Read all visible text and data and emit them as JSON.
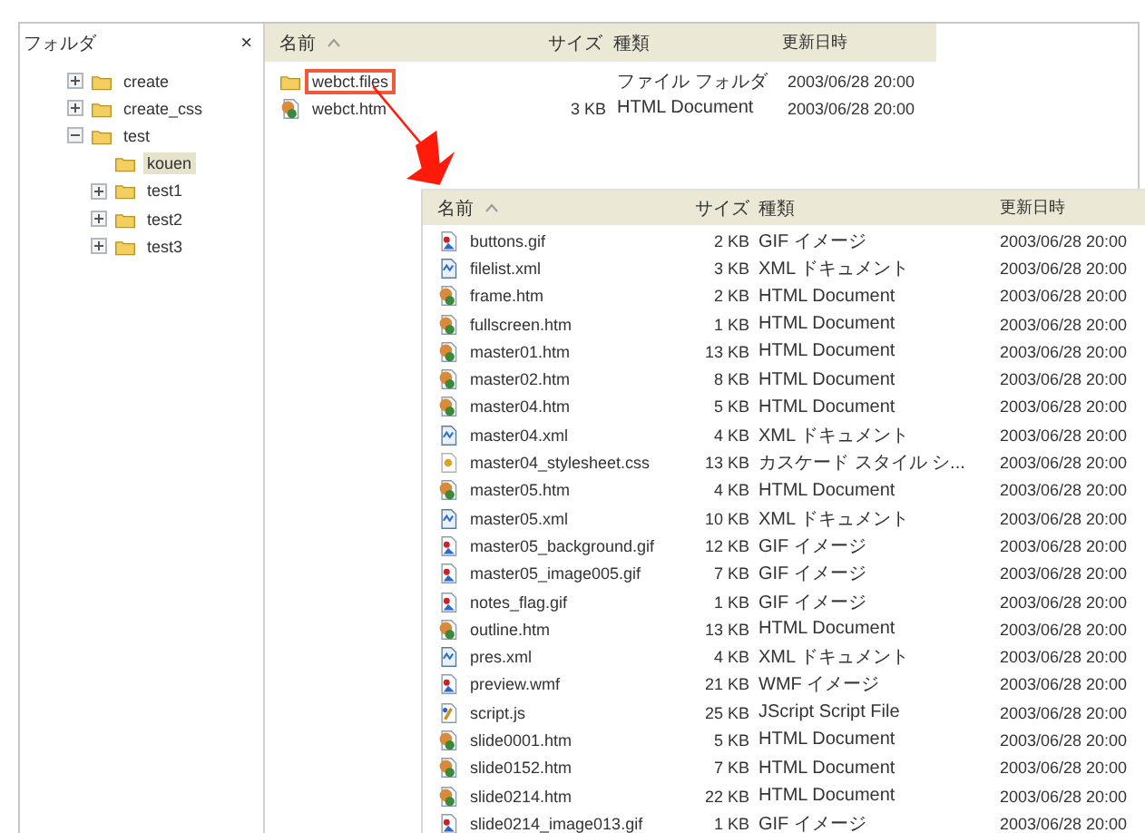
{
  "folder_pane": {
    "title": "フォルダ",
    "close": "×",
    "tree": [
      {
        "kind": "branch",
        "label": "create",
        "expanded": false,
        "selected": false
      },
      {
        "kind": "branch",
        "label": "create_css",
        "expanded": false,
        "selected": false
      },
      {
        "kind": "branch",
        "label": "test",
        "expanded": true,
        "selected": false,
        "children": [
          {
            "kind": "leaf",
            "label": "kouen",
            "expanded": false,
            "selected": true
          },
          {
            "kind": "branch",
            "label": "test1",
            "expanded": false,
            "selected": false
          },
          {
            "kind": "branch",
            "label": "test2",
            "expanded": false,
            "selected": false
          },
          {
            "kind": "branch",
            "label": "test3",
            "expanded": false,
            "selected": false
          }
        ]
      }
    ]
  },
  "folder_contents": {
    "columns": [
      "名前",
      "サイズ",
      "種類",
      "更新日時"
    ],
    "rows": [
      {
        "kind": "folder",
        "name": "webct.files",
        "size": "",
        "type": "ファイル フォルダ",
        "modified": "2003/06/28 20:00",
        "highlighted": true
      },
      {
        "kind": "htm",
        "name": "webct.htm",
        "size": "3 KB",
        "type": "HTML Document",
        "modified": "2003/06/28 20:00",
        "highlighted": false
      }
    ]
  },
  "subfolder_contents": {
    "columns": [
      "名前",
      "サイズ",
      "種類",
      "更新日時"
    ],
    "rows": [
      {
        "kind": "gif",
        "name": "buttons.gif",
        "size": "2 KB",
        "type": "GIF イメージ",
        "modified": "2003/06/28 20:00"
      },
      {
        "kind": "xml",
        "name": "filelist.xml",
        "size": "3 KB",
        "type": "XML ドキュメント",
        "modified": "2003/06/28 20:00"
      },
      {
        "kind": "htm",
        "name": "frame.htm",
        "size": "2 KB",
        "type": "HTML Document",
        "modified": "2003/06/28 20:00"
      },
      {
        "kind": "htm",
        "name": "fullscreen.htm",
        "size": "1 KB",
        "type": "HTML Document",
        "modified": "2003/06/28 20:00"
      },
      {
        "kind": "htm",
        "name": "master01.htm",
        "size": "13 KB",
        "type": "HTML Document",
        "modified": "2003/06/28 20:00"
      },
      {
        "kind": "htm",
        "name": "master02.htm",
        "size": "8 KB",
        "type": "HTML Document",
        "modified": "2003/06/28 20:00"
      },
      {
        "kind": "htm",
        "name": "master04.htm",
        "size": "5 KB",
        "type": "HTML Document",
        "modified": "2003/06/28 20:00"
      },
      {
        "kind": "xml",
        "name": "master04.xml",
        "size": "4 KB",
        "type": "XML ドキュメント",
        "modified": "2003/06/28 20:00"
      },
      {
        "kind": "css",
        "name": "master04_stylesheet.css",
        "size": "13 KB",
        "type": "カスケード スタイル シ...",
        "modified": "2003/06/28 20:00"
      },
      {
        "kind": "htm",
        "name": "master05.htm",
        "size": "4 KB",
        "type": "HTML Document",
        "modified": "2003/06/28 20:00"
      },
      {
        "kind": "xml",
        "name": "master05.xml",
        "size": "10 KB",
        "type": "XML ドキュメント",
        "modified": "2003/06/28 20:00"
      },
      {
        "kind": "gif",
        "name": "master05_background.gif",
        "size": "12 KB",
        "type": "GIF イメージ",
        "modified": "2003/06/28 20:00"
      },
      {
        "kind": "gif",
        "name": "master05_image005.gif",
        "size": "7 KB",
        "type": "GIF イメージ",
        "modified": "2003/06/28 20:00"
      },
      {
        "kind": "gif",
        "name": "notes_flag.gif",
        "size": "1 KB",
        "type": "GIF イメージ",
        "modified": "2003/06/28 20:00"
      },
      {
        "kind": "htm",
        "name": "outline.htm",
        "size": "13 KB",
        "type": "HTML Document",
        "modified": "2003/06/28 20:00"
      },
      {
        "kind": "xml",
        "name": "pres.xml",
        "size": "4 KB",
        "type": "XML ドキュメント",
        "modified": "2003/06/28 20:00"
      },
      {
        "kind": "gif",
        "name": "preview.wmf",
        "size": "21 KB",
        "type": "WMF イメージ",
        "modified": "2003/06/28 20:00"
      },
      {
        "kind": "js",
        "name": "script.js",
        "size": "25 KB",
        "type": "JScript Script File",
        "modified": "2003/06/28 20:00"
      },
      {
        "kind": "htm",
        "name": "slide0001.htm",
        "size": "5 KB",
        "type": "HTML Document",
        "modified": "2003/06/28 20:00"
      },
      {
        "kind": "htm",
        "name": "slide0152.htm",
        "size": "7 KB",
        "type": "HTML Document",
        "modified": "2003/06/28 20:00"
      },
      {
        "kind": "htm",
        "name": "slide0214.htm",
        "size": "22 KB",
        "type": "HTML Document",
        "modified": "2003/06/28 20:00"
      },
      {
        "kind": "gif",
        "name": "slide0214_image013.gif",
        "size": "1 KB",
        "type": "GIF イメージ",
        "modified": "2003/06/28 20:00"
      }
    ]
  }
}
